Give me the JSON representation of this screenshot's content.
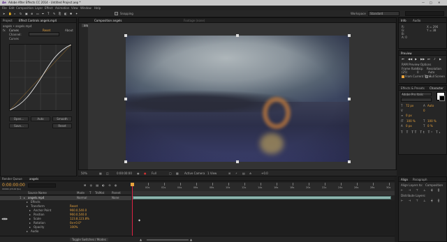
{
  "window": {
    "title": "Adobe After Effects CC 2014 - Untitled Project.aep *"
  },
  "menu": [
    "File",
    "Edit",
    "Composition",
    "Layer",
    "Effect",
    "Animation",
    "View",
    "Window",
    "Help"
  ],
  "toolbar": {
    "snapping": "Snapping",
    "workspace_label": "Workspace",
    "workspace_value": "Standard"
  },
  "left_panel": {
    "tabs": [
      "Project",
      "Effect Controls angels.mp4"
    ],
    "breadcrumb": "angels • angels.mp4",
    "effect": {
      "name": "Curves",
      "reset": "Reset",
      "about": "About",
      "channel": "Channel:",
      "curves": "Curves"
    },
    "buttons_row1": [
      "Open...",
      "Auto",
      "Smooth"
    ],
    "buttons_row2": [
      "Save...",
      "Reset"
    ]
  },
  "viewer": {
    "tab": "Composition angels",
    "footage_tab": "Footage (none)",
    "comp_chip": "angels",
    "bottom": {
      "zoom": "50%",
      "timecode": "0:00:00:00",
      "res": "Full",
      "camera": "Active Camera",
      "view": "1 View",
      "exposure": "+0.0"
    }
  },
  "info_panel": {
    "tabs": [
      "Info",
      "Audio"
    ],
    "x": "X = 296",
    "y": "Y = 38",
    "r": "R:",
    "g": "G:",
    "b": "B:",
    "a": "A: 0"
  },
  "preview_panel": {
    "title": "Preview",
    "ram": "RAM Preview Options",
    "frame_rate": "Frame Rate",
    "skip": "Skip",
    "resolution": "Resolution",
    "fr_val": "(25)",
    "skip_val": "0",
    "res_val": "Auto",
    "from_current": "From Current Time",
    "full_screen": "Full Screen"
  },
  "char_panel": {
    "tabs": [
      "Effects & Presets",
      "Character"
    ],
    "font": "Adobe Pro Italic",
    "size": "72 px",
    "leading": "Auto",
    "tracking": "0",
    "px": "0 px",
    "scale_v": "100 %",
    "scale_h": "100 %",
    "baseline": "0 px",
    "tsume": "0 %"
  },
  "align_panel": {
    "tabs": [
      "Align",
      "Paragraph"
    ],
    "align_to": "Align Layers to:",
    "align_val": "Composition",
    "distribute": "Distribute Layers:"
  },
  "timeline": {
    "tabs": [
      "Render Queue",
      "angels"
    ],
    "timecode": "0:00:00:00",
    "frames": "00000 (25.00 fps)",
    "columns": [
      "Source Name",
      "Mode",
      "T",
      "TrkMat",
      "Parent"
    ],
    "ruler": [
      "00s",
      "02s",
      "04s",
      "06s",
      "08s",
      "10s",
      "12s",
      "14s",
      "16s",
      "18s",
      "20s",
      "22s",
      "24s",
      "26s",
      "28s",
      "30s"
    ],
    "rows": [
      {
        "label": "1",
        "name": "angels.mp4",
        "value": "",
        "mode": "Normal",
        "parent": "None"
      },
      {
        "label": "",
        "name": "Effects",
        "value": ""
      },
      {
        "label": "",
        "name": "Transform",
        "value": "Reset"
      },
      {
        "label": "",
        "name": "Anchor Point",
        "value": "960.0,540.0"
      },
      {
        "label": "",
        "name": "Position",
        "value": "960.0,540.0"
      },
      {
        "label": "",
        "name": "Scale",
        "value": "123.8,123.8%"
      },
      {
        "label": "",
        "name": "Rotation",
        "value": "0x+0.0°"
      },
      {
        "label": "",
        "name": "Opacity",
        "value": "100%"
      },
      {
        "label": "",
        "name": "Audio",
        "value": ""
      }
    ],
    "footer": "Toggle Switches / Modes"
  }
}
